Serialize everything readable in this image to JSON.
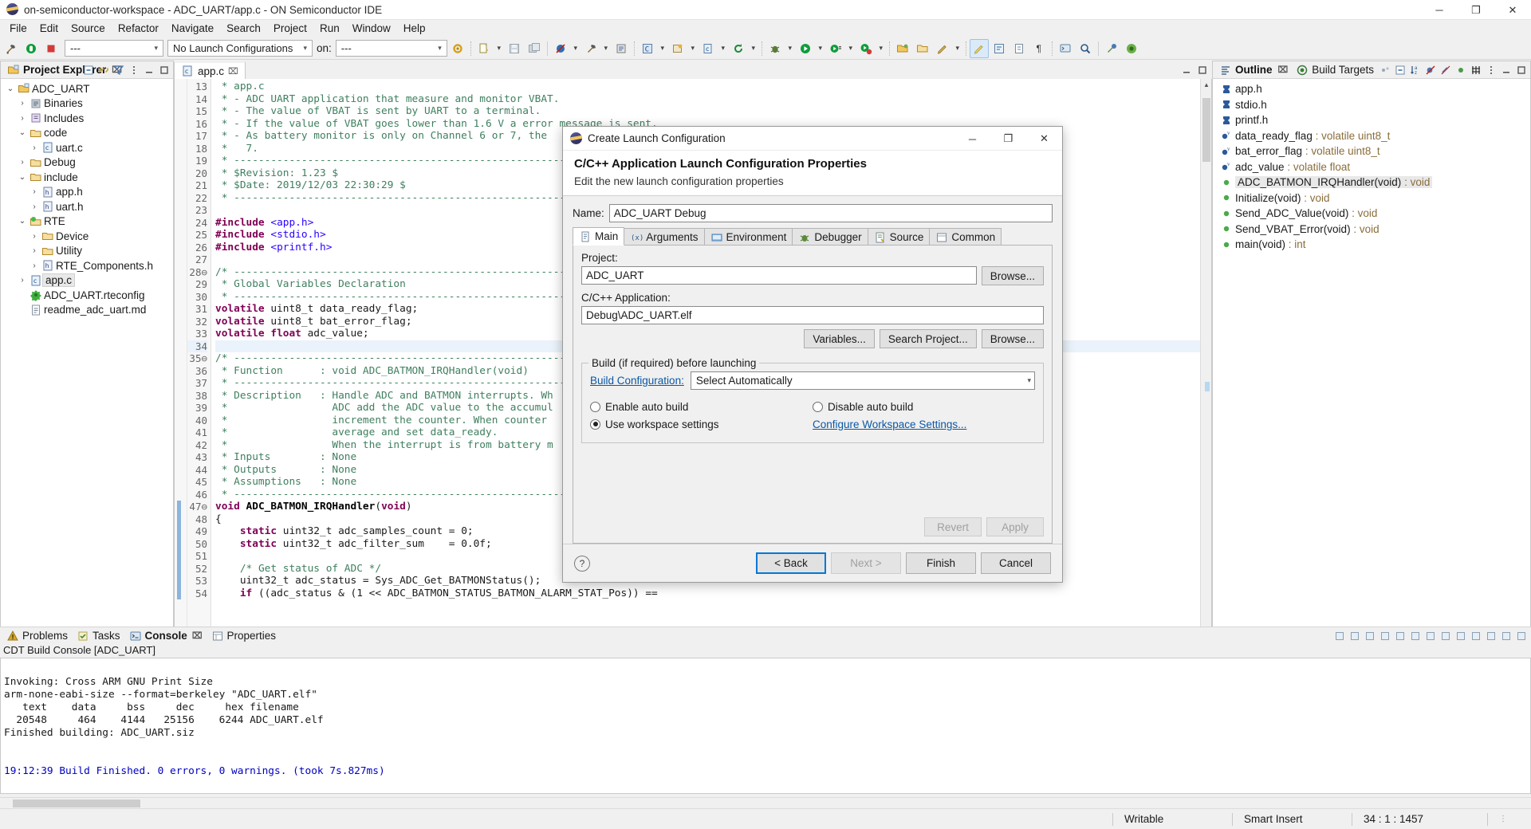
{
  "window": {
    "title": "on-semiconductor-workspace - ADC_UART/app.c - ON Semiconductor IDE",
    "minimize": "─",
    "maximize": "❐",
    "close": "✕"
  },
  "menubar": {
    "items": [
      "File",
      "Edit",
      "Source",
      "Refactor",
      "Navigate",
      "Search",
      "Project",
      "Run",
      "Window",
      "Help"
    ]
  },
  "toolbar": {
    "combo_build": "---",
    "combo_launch": "No Launch Configurations",
    "on_label": "on:",
    "combo_target": "---",
    "icons": [
      "build-hammer-icon",
      "debug-resume-icon",
      "terminate-stop-icon",
      "new-wizard-icon",
      "save-icon",
      "save-all-icon",
      "skip-breakpoints-icon",
      "build-icon",
      "build-all-icon",
      "open-type-icon",
      "new-class-icon",
      "new-c-file-icon",
      "search-icon",
      "debug-icon",
      "run-icon",
      "external-tools-icon",
      "profile-icon",
      "open-perspective-icon",
      "next-annotation-icon",
      "previous-annotation-icon",
      "last-edit-icon",
      "back-icon",
      "forward-icon",
      "pin-editor-icon"
    ]
  },
  "explorer": {
    "tab": "Project Explorer",
    "close_glyph": "⌧",
    "tools": [
      "collapse-all-icon",
      "link-with-editor-icon",
      "view-filter-icon",
      "view-menu-icon",
      "minimize-icon",
      "maximize-icon"
    ],
    "tree": [
      {
        "label": "ADC_UART",
        "indent": 0,
        "twisty": "⌄",
        "icon": "project-folder-icon",
        "selected": false
      },
      {
        "label": "Binaries",
        "indent": 1,
        "twisty": "›",
        "icon": "binaries-icon",
        "selected": false
      },
      {
        "label": "Includes",
        "indent": 1,
        "twisty": "›",
        "icon": "includes-icon",
        "selected": false
      },
      {
        "label": "code",
        "indent": 1,
        "twisty": "⌄",
        "icon": "folder-icon",
        "selected": false
      },
      {
        "label": "uart.c",
        "indent": 2,
        "twisty": "›",
        "icon": "c-file-icon",
        "selected": false
      },
      {
        "label": "Debug",
        "indent": 1,
        "twisty": "›",
        "icon": "folder-icon",
        "selected": false
      },
      {
        "label": "include",
        "indent": 1,
        "twisty": "⌄",
        "icon": "folder-icon",
        "selected": false
      },
      {
        "label": "app.h",
        "indent": 2,
        "twisty": "›",
        "icon": "h-file-icon",
        "selected": false
      },
      {
        "label": "uart.h",
        "indent": 2,
        "twisty": "›",
        "icon": "h-file-icon",
        "selected": false
      },
      {
        "label": "RTE",
        "indent": 1,
        "twisty": "⌄",
        "icon": "rte-folder-icon",
        "selected": false
      },
      {
        "label": "Device",
        "indent": 2,
        "twisty": "›",
        "icon": "folder-icon",
        "selected": false
      },
      {
        "label": "Utility",
        "indent": 2,
        "twisty": "›",
        "icon": "folder-icon",
        "selected": false
      },
      {
        "label": "RTE_Components.h",
        "indent": 2,
        "twisty": "›",
        "icon": "h-file-icon",
        "selected": false
      },
      {
        "label": "app.c",
        "indent": 1,
        "twisty": "›",
        "icon": "c-file-icon",
        "selected": true
      },
      {
        "label": "ADC_UART.rteconfig",
        "indent": 1,
        "twisty": "",
        "icon": "rteconfig-icon",
        "selected": false
      },
      {
        "label": "readme_adc_uart.md",
        "indent": 1,
        "twisty": "",
        "icon": "md-file-icon",
        "selected": false
      }
    ]
  },
  "editor": {
    "tab": "app.c",
    "tab_icon": "c-file-icon",
    "close_glyph": "⌧",
    "first_line_number": 13,
    "highlight_line": 34,
    "current_function_line": 47,
    "lines": [
      {
        "n": 13,
        "html": "<span class='cmt'> * app.c</span>"
      },
      {
        "n": 14,
        "html": "<span class='cmt'> * - ADC UART application that measure and monitor VBAT.</span>"
      },
      {
        "n": 15,
        "html": "<span class='cmt'> * - The value of VBAT is sent by UART to a terminal.</span>"
      },
      {
        "n": 16,
        "html": "<span class='cmt'> * - If the value of VBAT goes lower than 1.6 V a error message is sent.</span>"
      },
      {
        "n": 17,
        "html": "<span class='cmt'> * - As battery monitor is only on Channel 6 or 7, the</span>"
      },
      {
        "n": 18,
        "html": "<span class='cmt'> *   7.</span>"
      },
      {
        "n": 19,
        "html": "<span class='cmt'> * ------------------------------------------------------------------</span>"
      },
      {
        "n": 20,
        "html": "<span class='cmt'> * $Revision: 1.23 $</span>"
      },
      {
        "n": 21,
        "html": "<span class='cmt'> * $Date: 2019/12/03 22:30:29 $</span>"
      },
      {
        "n": 22,
        "html": "<span class='cmt'> * ------------------------------------------------------------------</span>"
      },
      {
        "n": 23,
        "html": ""
      },
      {
        "n": 24,
        "html": "<span class='pp'>#include</span> <span class='str'>&lt;app.h&gt;</span>"
      },
      {
        "n": 25,
        "html": "<span class='pp'>#include</span> <span class='str'>&lt;stdio.h&gt;</span>"
      },
      {
        "n": 26,
        "html": "<span class='pp'>#include</span> <span class='str'>&lt;printf.h&gt;</span>"
      },
      {
        "n": 27,
        "html": ""
      },
      {
        "n": 28,
        "html": "<span class='cmt'>/* -----------------------------------------------------------------</span>"
      },
      {
        "n": 29,
        "html": "<span class='cmt'> * Global Variables Declaration</span>"
      },
      {
        "n": 30,
        "html": "<span class='cmt'> * -----------------------------------------------------------------</span>"
      },
      {
        "n": 31,
        "html": "<span class='kw'>volatile</span> uint8_t data_ready_flag;"
      },
      {
        "n": 32,
        "html": "<span class='kw'>volatile</span> uint8_t bat_error_flag;"
      },
      {
        "n": 33,
        "html": "<span class='kw'>volatile</span> <span class='kw'>float</span> adc_value;"
      },
      {
        "n": 34,
        "html": ""
      },
      {
        "n": 35,
        "html": "<span class='cmt'>/* -----------------------------------------------------------------</span>"
      },
      {
        "n": 36,
        "html": "<span class='cmt'> * Function      : void ADC_BATMON_IRQHandler(void)</span>"
      },
      {
        "n": 37,
        "html": "<span class='cmt'> * -----------------------------------------------------------------</span>"
      },
      {
        "n": 38,
        "html": "<span class='cmt'> * Description   : Handle ADC and BATMON interrupts. Wh</span>"
      },
      {
        "n": 39,
        "html": "<span class='cmt'> *                 ADC add the ADC value to the accumul</span>"
      },
      {
        "n": 40,
        "html": "<span class='cmt'> *                 increment the counter. When counter</span>"
      },
      {
        "n": 41,
        "html": "<span class='cmt'> *                 average and set data_ready.</span>"
      },
      {
        "n": 42,
        "html": "<span class='cmt'> *                 When the interrupt is from battery m</span>"
      },
      {
        "n": 43,
        "html": "<span class='cmt'> * Inputs        : None</span>"
      },
      {
        "n": 44,
        "html": "<span class='cmt'> * Outputs       : None</span>"
      },
      {
        "n": 45,
        "html": "<span class='cmt'> * Assumptions   : None</span>"
      },
      {
        "n": 46,
        "html": "<span class='cmt'> * -----------------------------------------------------------------</span>"
      },
      {
        "n": 47,
        "html": "<span class='kw'>void</span> <span class='fn'>ADC_BATMON_IRQHandler</span>(<span class='kw'>void</span>)"
      },
      {
        "n": 48,
        "html": "{"
      },
      {
        "n": 49,
        "html": "    <span class='kw'>static</span> uint32_t adc_samples_count = 0;"
      },
      {
        "n": 50,
        "html": "    <span class='kw'>static</span> uint32_t adc_filter_sum    = 0.0f;"
      },
      {
        "n": 51,
        "html": ""
      },
      {
        "n": 52,
        "html": "    <span class='cmt'>/* Get status of ADC */</span>"
      },
      {
        "n": 53,
        "html": "    uint32_t adc_status = Sys_ADC_Get_BATMONStatus();"
      },
      {
        "n": 54,
        "html": "    <span class='kw'>if</span> ((adc_status &amp; (1 &lt;&lt; ADC_BATMON_STATUS_BATMON_ALARM_STAT_Pos)) =="
      }
    ]
  },
  "outline": {
    "tab": "Outline",
    "tab2": "Build Targets",
    "close_glyph": "⌧",
    "tools": [
      "focus-on-active-task-icon",
      "collapse-all-icon",
      "sort-icon",
      "hide-fields-icon",
      "hide-static-icon",
      "hide-nonpublic-icon",
      "link-icon",
      "view-menu-icon",
      "minimize-icon",
      "maximize-icon"
    ],
    "items": [
      {
        "name": "app.h",
        "type": "",
        "icon": "include-icon",
        "selected": false
      },
      {
        "name": "stdio.h",
        "type": "",
        "icon": "include-icon",
        "selected": false
      },
      {
        "name": "printf.h",
        "type": "",
        "icon": "include-icon",
        "selected": false
      },
      {
        "name": "data_ready_flag",
        "type": " : volatile uint8_t",
        "icon": "variable-icon",
        "selected": false
      },
      {
        "name": "bat_error_flag",
        "type": " : volatile uint8_t",
        "icon": "variable-icon",
        "selected": false
      },
      {
        "name": "adc_value",
        "type": " : volatile float",
        "icon": "variable-icon",
        "selected": false
      },
      {
        "name": "ADC_BATMON_IRQHandler(void)",
        "type": " : void",
        "icon": "function-icon",
        "selected": true
      },
      {
        "name": "Initialize(void)",
        "type": " : void",
        "icon": "function-icon",
        "selected": false
      },
      {
        "name": "Send_ADC_Value(void)",
        "type": " : void",
        "icon": "function-icon",
        "selected": false
      },
      {
        "name": "Send_VBAT_Error(void)",
        "type": " : void",
        "icon": "function-icon",
        "selected": false
      },
      {
        "name": "main(void)",
        "type": " : int",
        "icon": "function-icon",
        "selected": false
      }
    ]
  },
  "console": {
    "tabs": [
      {
        "label": "Problems",
        "icon": "problems-icon",
        "active": false
      },
      {
        "label": "Tasks",
        "icon": "tasks-icon",
        "active": false
      },
      {
        "label": "Console",
        "icon": "console-icon",
        "active": true
      },
      {
        "label": "Properties",
        "icon": "properties-icon",
        "active": false
      }
    ],
    "close_glyph": "⌧",
    "subtitle": "CDT Build Console [ADC_UART]",
    "tools": [
      "terminate-icon",
      "remove-launch-icon",
      "remove-all-icon",
      "clear-console-icon",
      "scroll-lock-icon",
      "word-wrap-icon",
      "pin-console-icon",
      "display-console-icon",
      "open-console-icon",
      "new-console-view-icon",
      "view-menu-icon",
      "minimize-icon",
      "maximize-icon"
    ],
    "lines": [
      {
        "text": "",
        "blue": false
      },
      {
        "text": "Invoking: Cross ARM GNU Print Size",
        "blue": false
      },
      {
        "text": "arm-none-eabi-size --format=berkeley \"ADC_UART.elf\"",
        "blue": false
      },
      {
        "text": "   text    data     bss     dec     hex filename",
        "blue": false
      },
      {
        "text": "  20548     464    4144   25156    6244 ADC_UART.elf",
        "blue": false
      },
      {
        "text": "Finished building: ADC_UART.siz",
        "blue": false
      },
      {
        "text": "",
        "blue": false
      },
      {
        "text": "",
        "blue": false
      },
      {
        "text": "19:12:39 Build Finished. 0 errors, 0 warnings. (took 7s.827ms)",
        "blue": true
      }
    ]
  },
  "statusbar": {
    "writable": "Writable",
    "insert_mode": "Smart Insert",
    "position": "34 : 1 : 1457"
  },
  "dialog": {
    "title": "Create Launch Configuration",
    "icon": "eclipse-icon",
    "minimize": "─",
    "maximize": "❐",
    "close": "✕",
    "heading": "C/C++ Application Launch Configuration Properties",
    "subheading": "Edit the new launch configuration properties",
    "name_label": "Name:",
    "name_value": "ADC_UART Debug",
    "tabs": [
      {
        "label": "Main",
        "icon": "main-tab-icon",
        "active": true
      },
      {
        "label": "Arguments",
        "icon": "arguments-tab-icon",
        "active": false
      },
      {
        "label": "Environment",
        "icon": "environment-tab-icon",
        "active": false
      },
      {
        "label": "Debugger",
        "icon": "debugger-tab-icon",
        "active": false
      },
      {
        "label": "Source",
        "icon": "source-tab-icon",
        "active": false
      },
      {
        "label": "Common",
        "icon": "common-tab-icon",
        "active": false
      }
    ],
    "project_label": "Project:",
    "project_value": "ADC_UART",
    "project_browse": "Browse...",
    "app_label": "C/C++ Application:",
    "app_value": "Debug\\ADC_UART.elf",
    "app_buttons": [
      "Variables...",
      "Search Project...",
      "Browse..."
    ],
    "build_group_legend": "Build (if required) before launching",
    "build_config_link": "Build Configuration:",
    "build_config_value": "Select Automatically",
    "build_config_arrow": "⌄",
    "radios": [
      {
        "label": "Enable auto build",
        "checked": false
      },
      {
        "label": "Disable auto build",
        "checked": false
      },
      {
        "label": "Use workspace settings",
        "checked": true
      }
    ],
    "configure_link": "Configure Workspace Settings...",
    "revert": "Revert",
    "apply": "Apply",
    "help_glyph": "?",
    "back": "< Back",
    "next": "Next >",
    "finish": "Finish",
    "cancel": "Cancel"
  },
  "colors": {
    "accent": "#0078d7",
    "link": "#0b57a4",
    "comment": "#3f7f5f",
    "keyword": "#7f0055",
    "string": "#2a00ff",
    "console_blue": "#0000c0",
    "selection": "#e8e8e8"
  }
}
